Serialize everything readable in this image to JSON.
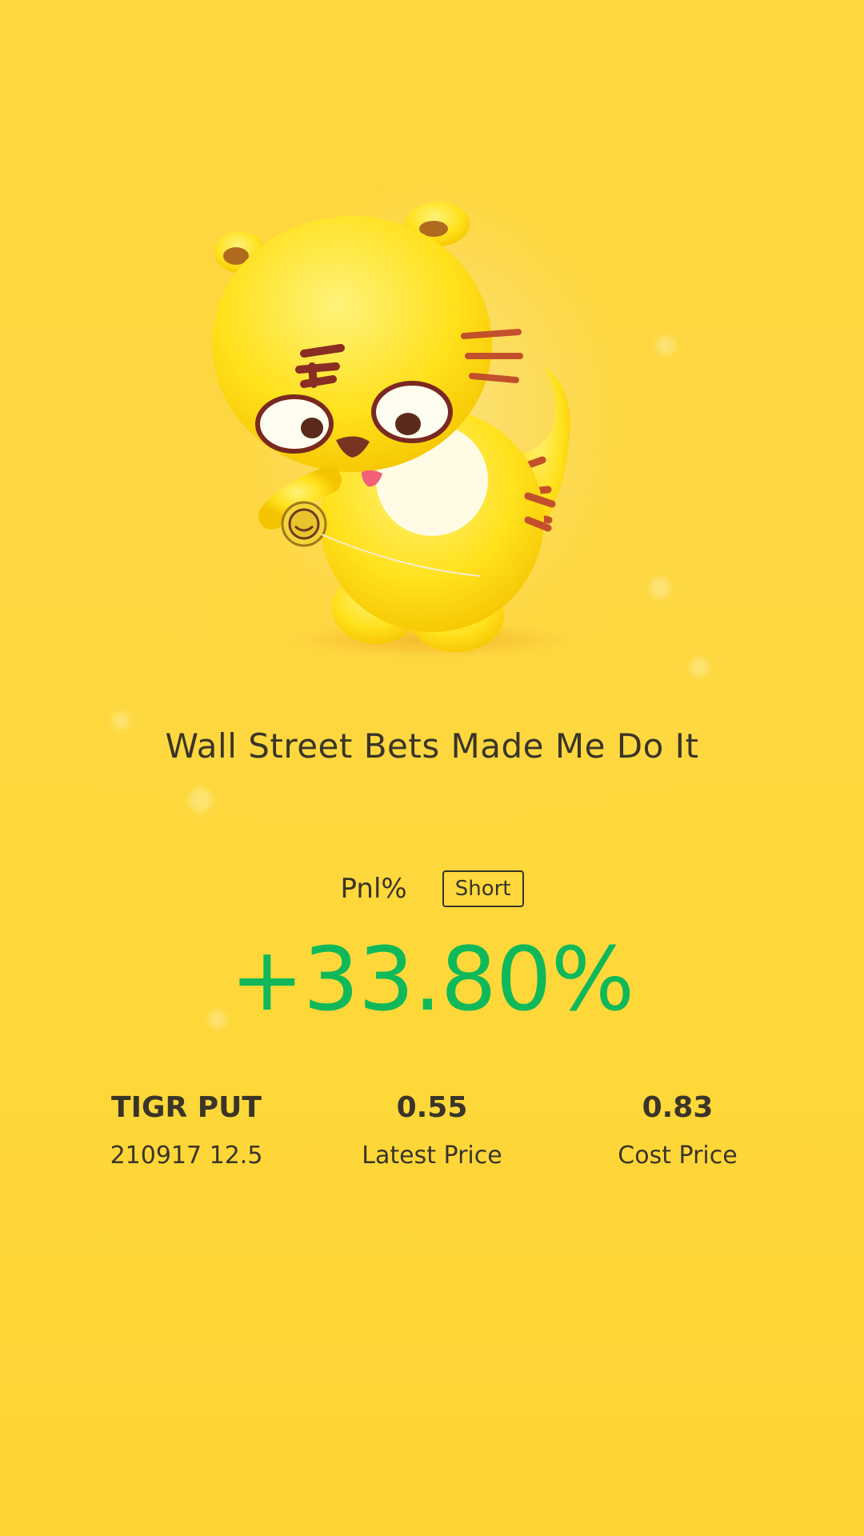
{
  "title": "Wall Street Bets Made Me Do It",
  "pnl": {
    "label": "Pnl%",
    "direction": "Short",
    "value": "+33.80%"
  },
  "stats": [
    {
      "main": "TIGR PUT",
      "sub": "210917 12.5"
    },
    {
      "main": "0.55",
      "sub": "Latest Price"
    },
    {
      "main": "0.83",
      "sub": "Cost Price"
    }
  ],
  "colors": {
    "background": "#fed83a",
    "positive": "#0fb95a",
    "text": "#3a3528"
  },
  "illustration": "tiger-mascot-with-yoyo"
}
